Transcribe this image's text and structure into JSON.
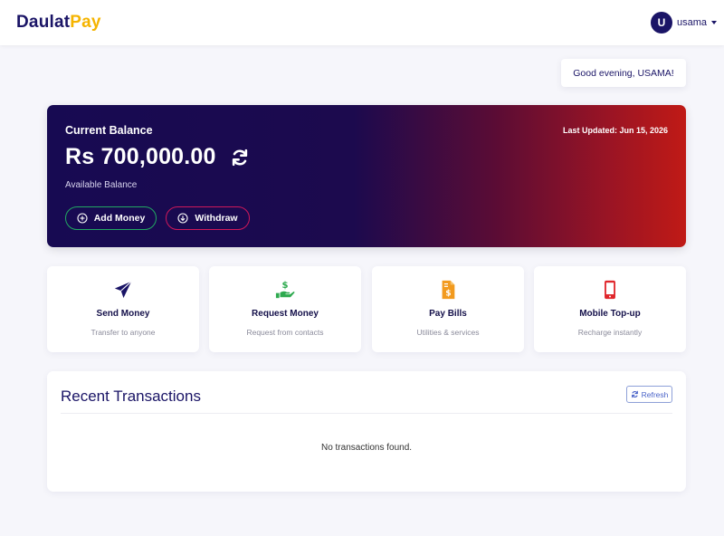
{
  "brand": {
    "part1": "Daulat",
    "part2": "Pay"
  },
  "user": {
    "initial": "U",
    "name": "usama"
  },
  "greeting": "Good evening, USAMA!",
  "balance": {
    "title": "Current Balance",
    "last_updated": "Last Updated: Jun 15, 2026",
    "amount": "Rs 700,000.00",
    "subtitle": "Available Balance",
    "add_label": "Add Money",
    "withdraw_label": "Withdraw"
  },
  "actions": [
    {
      "title": "Send Money",
      "subtitle": "Transfer to anyone",
      "icon": "paper-plane-icon",
      "color": "#1a1466"
    },
    {
      "title": "Request Money",
      "subtitle": "Request from contacts",
      "icon": "hand-dollar-icon",
      "color": "#2eaa4f"
    },
    {
      "title": "Pay Bills",
      "subtitle": "Utilities & services",
      "icon": "invoice-icon",
      "color": "#f29a1e"
    },
    {
      "title": "Mobile Top-up",
      "subtitle": "Recharge instantly",
      "icon": "mobile-phone-icon",
      "color": "#e0262b"
    }
  ],
  "transactions": {
    "title": "Recent Transactions",
    "refresh_label": "Refresh",
    "empty_text": "No transactions found."
  },
  "colors": {
    "primary": "#1a1466",
    "brand_accent": "#f5b400",
    "add_border": "#22a862",
    "withdraw_border": "#d0185a"
  }
}
